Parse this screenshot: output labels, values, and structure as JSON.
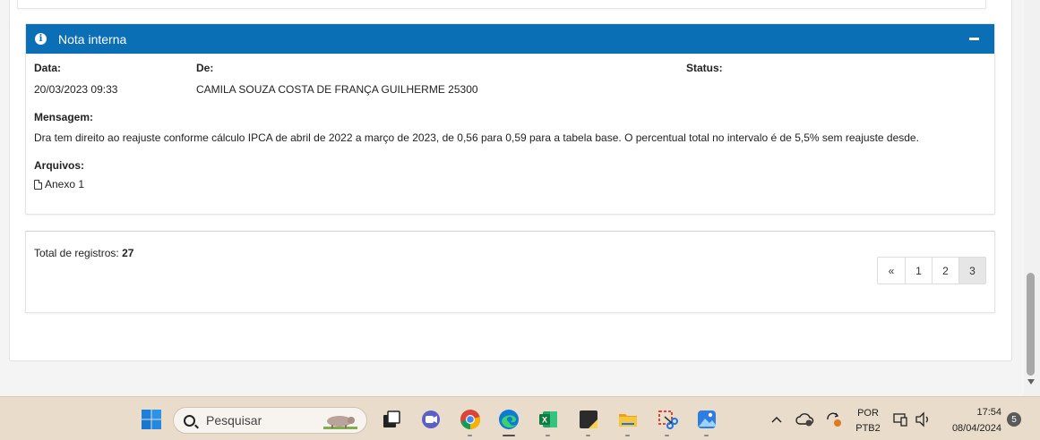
{
  "note": {
    "title": "Nota interna",
    "date_label": "Data:",
    "date_value": "20/03/2023 09:33",
    "from_label": "De:",
    "from_value": "CAMILA SOUZA COSTA DE FRANÇA GUILHERME 25300",
    "status_label": "Status:",
    "message_label": "Mensagem:",
    "message_value": "Dra tem direito ao reajuste conforme cálculo IPCA de abril de 2022 a março de 2023, de 0,56 para 0,59 para a tabela base. O percentual total no intervalo é de 5,5% sem reajuste desde.",
    "files_label": "Arquivos:",
    "file_name": "Anexo 1"
  },
  "footer": {
    "total_label": "Total de registros:",
    "total_value": "27",
    "pages": [
      "«",
      "1",
      "2",
      "3"
    ],
    "active_page": "3"
  },
  "taskbar": {
    "search_placeholder": "Pesquisar",
    "language": "POR",
    "keyboard": "PTB2",
    "time": "17:54",
    "date": "08/04/2024",
    "notification_count": "5",
    "icons": [
      "windows-start",
      "search",
      "task-view",
      "teams-chat",
      "chrome",
      "edge",
      "excel",
      "sticky-notes",
      "file-explorer",
      "snipping-tool",
      "photos"
    ]
  },
  "colors": {
    "header_blue": "#0b6fb6",
    "taskbar": "#e9dccb"
  }
}
